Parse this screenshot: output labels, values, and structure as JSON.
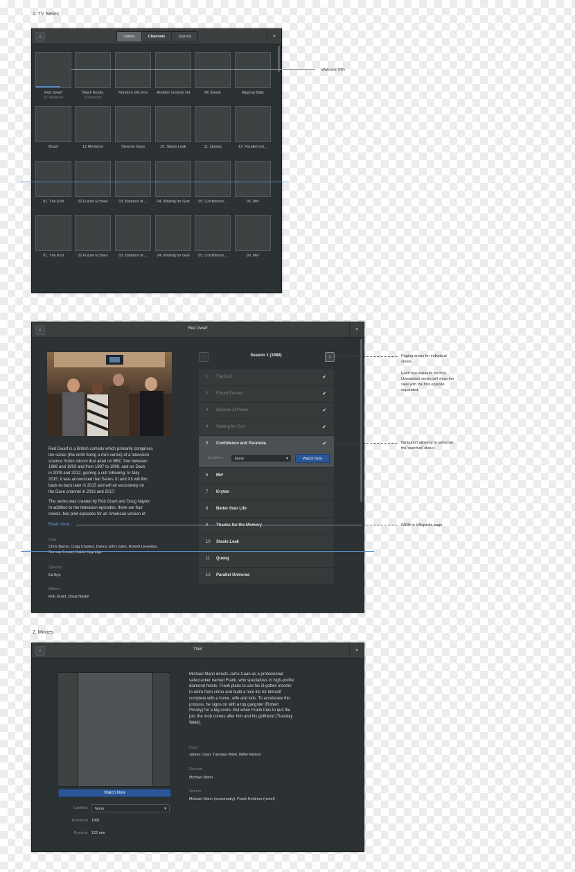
{
  "sections": {
    "tv_title": "1. TV Series",
    "movies_title": "2. Movies"
  },
  "browser": {
    "tabs": [
      {
        "label": "Videos"
      },
      {
        "label": "Channels"
      },
      {
        "label": "Starred"
      }
    ],
    "back_icon": "chevron-left-icon",
    "close_icon": "close-icon",
    "close_glyph": "×",
    "back_glyph": "‹",
    "watched_fraction": 0.7,
    "row1": [
      {
        "title": "Red Dwarf",
        "subtitle": "10 Seasons"
      },
      {
        "title": "Black Books",
        "subtitle": "3 Seasons"
      },
      {
        "title": "Random Vid.mov",
        "subtitle": ""
      },
      {
        "title": "Another random vid",
        "subtitle": ""
      },
      {
        "title": "Mr Steele",
        "subtitle": ""
      },
      {
        "title": "Ripping Balls",
        "subtitle": ""
      }
    ],
    "row2": [
      {
        "title": "Brazil"
      },
      {
        "title": "12 Monkeys"
      },
      {
        "title": "Slowmo Guys"
      },
      {
        "title": "10. Stasis Leak"
      },
      {
        "title": "11. Queeg"
      },
      {
        "title": "12. Parallel Uni..."
      }
    ],
    "row3": [
      {
        "title": "01. The End"
      },
      {
        "title": "02.Future Echoes"
      },
      {
        "title": "03. Balance of ..."
      },
      {
        "title": "04. Waiting for God"
      },
      {
        "title": "05. Confidence..."
      },
      {
        "title": "06. Me²"
      }
    ],
    "row4": [
      {
        "title": "01. The End"
      },
      {
        "title": "02.Future Echoes"
      },
      {
        "title": "03. Balance of ..."
      },
      {
        "title": "04. Waiting for God"
      },
      {
        "title": "05. Confidence..."
      },
      {
        "title": "06. Me²"
      }
    ]
  },
  "notes": {
    "watched": "Watched 70%",
    "paging": [
      "Paging arows for individual",
      "series."
    ],
    "expand": [
      "Each row expands on click.",
      "Unwatched series will show the",
      "view with the first episode",
      "expanded."
    ],
    "flat_button": [
      "flat button allowing to set/unset",
      "the 'watched' status"
    ],
    "imdb": "IMDB or Wikipedia page."
  },
  "series": {
    "window_title": "Red Dwarf",
    "season_title": "Season 1 (1988)",
    "prev_icon": "chevron-left-icon",
    "next_icon": "chevron-right-icon",
    "prev_glyph": "‹",
    "next_glyph": "›",
    "poster_icon": "cast-photo",
    "description": [
      "Red Dwarf is a British comedy which primarily comprises",
      "ten series (the ninth being a mini-series) of a television",
      "science fiction sitcom that aired on BBC Two between",
      "1988 and 1993 and from 1997 to 1999, and on Dave",
      "in 2009 and 2012, gaining a cult following. In May",
      "2015, it was announced that Series XI and XII will film",
      "back-to-back later in 2015 and will air exclusively on",
      "the Dave channel in 2016 and 2017."
    ],
    "description2": [
      "The series was created by Rob Grant and Doug Naylor.",
      "In addition to the television episodes, there are four",
      "novels, two pilot episodes for an American version of"
    ],
    "read_more": "Read more...",
    "cast_label": "Cast",
    "cast": [
      "Chris Barrie, Craig Charles, Danny John-Jules, Robert Llewellyn,",
      "Norman Lovett, Hattie Hayridge"
    ],
    "director_label": "Director",
    "director": "Ed Bye",
    "writers_label": "Writers",
    "writers": "Rob Grant, Doug Naylor",
    "check_glyph": "✔",
    "episodes": [
      {
        "num": "1",
        "title": "The End",
        "watched": true
      },
      {
        "num": "2",
        "title": "Future Echoes",
        "watched": true
      },
      {
        "num": "3",
        "title": "Balance of Power",
        "watched": true
      },
      {
        "num": "4",
        "title": "Waiting for God",
        "watched": true
      },
      {
        "num": "5",
        "title": "Confidence and Paranoia",
        "watched": true
      },
      {
        "num": "6",
        "title": "Me²",
        "watched": false
      },
      {
        "num": "7",
        "title": "Kryten",
        "watched": false
      },
      {
        "num": "8",
        "title": "Better than Life",
        "watched": false
      },
      {
        "num": "9",
        "title": "Thanks for the Memory",
        "watched": false
      },
      {
        "num": "10",
        "title": "Stasis Leak",
        "watched": false
      },
      {
        "num": "11",
        "title": "Queeg",
        "watched": false
      },
      {
        "num": "12",
        "title": "Parallel Universe",
        "watched": false
      }
    ],
    "expanded": {
      "subtitles_label": "Subtitles",
      "subtitles_value": "None",
      "watch_label": "Watch Now"
    }
  },
  "movie": {
    "window_title": "Thief",
    "watch_label": "Watch Now",
    "subtitles_label": "Subtitles",
    "subtitles_value": "None",
    "released_label": "Released",
    "released": "1981",
    "runtime_label": "Runtime",
    "runtime": "122 min",
    "description": [
      "Michael Mann directs Jams Caan as a professional",
      "safecracker named Frank, who specializes in high-profile",
      "diamond heists. Frank plans to use his ill-gotten income",
      "to retire from crime and build a nice life for himself",
      "complete with a home, wife and kids. To accelerate this",
      "process, he signs on with a top gangster (Robert",
      "Prosky) for a big score. But when Frank tries to quit the",
      "job, the mob comes after him and his girlfriend (Tuesday",
      "Weld)."
    ],
    "cast_label": "Cast",
    "cast": "James Caan, Tuesday Weld, Willie Nelson",
    "director_label": "Director",
    "director": "Michael Mann",
    "writers_label": "Writers",
    "writers": "Michael Mann (screenpaly), Frank Hohimer (novel)",
    "caret_glyph": "▾"
  },
  "colors": {
    "accent": "#2b5797",
    "window_bg": "#2c3133",
    "header_bg": "#3b3f40",
    "guide_line": "#5b8cc6"
  }
}
